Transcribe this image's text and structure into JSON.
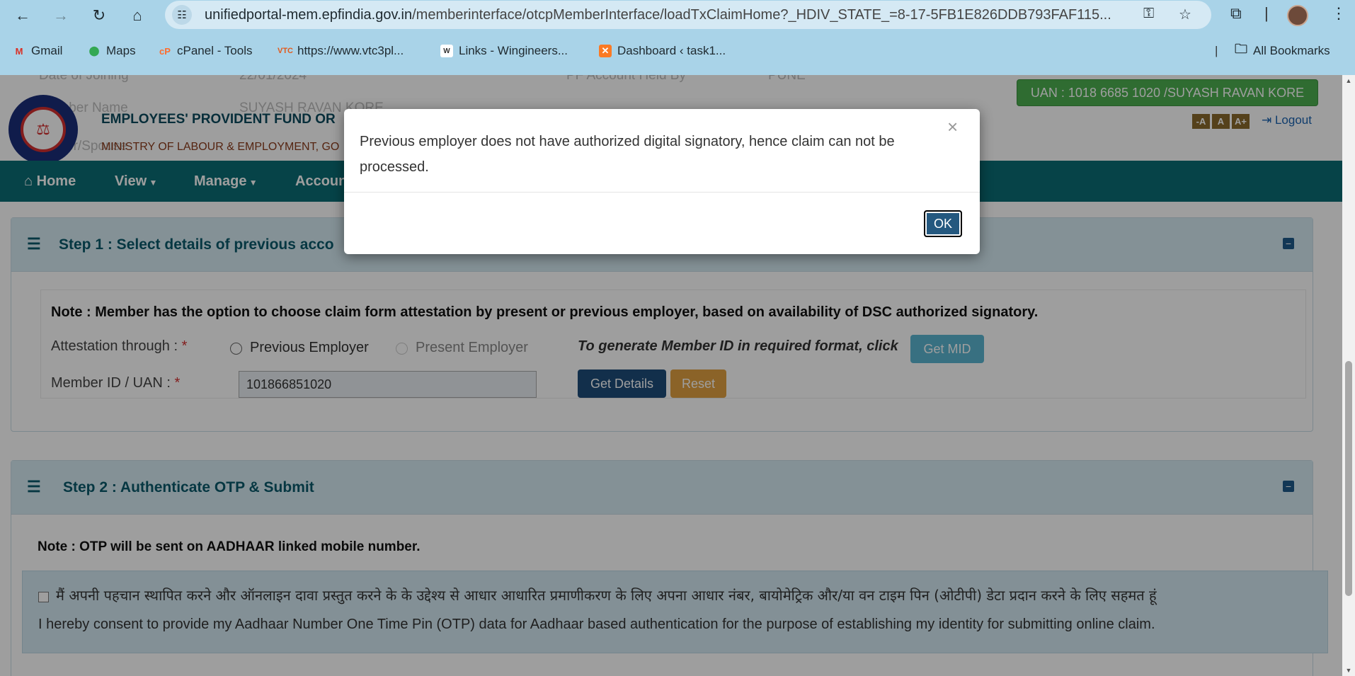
{
  "browser": {
    "url_host": "unifiedportal-mem.epfindia.gov.in",
    "url_path": "/memberinterface/otcpMemberInterface/loadTxClaimHome?_HDIV_STATE_=8-17-5FB1E826DDB793FAF115...",
    "bookmarks": [
      {
        "label": "Gmail",
        "icon": "gmail-icon"
      },
      {
        "label": "Maps",
        "icon": "maps-icon"
      },
      {
        "label": "cPanel - Tools",
        "icon": "cpanel-icon"
      },
      {
        "label": "https://www.vtc3pl...",
        "icon": "vtc-icon"
      },
      {
        "label": "Links - Wingineers...",
        "icon": "wingineers-icon"
      },
      {
        "label": "Dashboard ‹ task1...",
        "icon": "xampp-icon"
      }
    ],
    "all_bookmarks": "All Bookmarks"
  },
  "header": {
    "ghost_row1_label": "Date of Joining",
    "ghost_row1_value": "22/01/2024",
    "ghost_row1_label2": "PF Account Held By",
    "ghost_row1_value2": "PUNE",
    "ghost_row2_label": "Member Name",
    "ghost_row2_value": "SUYASH RAVAN KORE",
    "ghost_row3_label": "Father/Spouse",
    "org_title": "EMPLOYEES' PROVIDENT FUND OR",
    "org_subtitle": "MINISTRY OF LABOUR & EMPLOYMENT, GO",
    "uan_badge": "UAN : 1018 6685 1020 /SUYASH RAVAN KORE",
    "font_small": "-A",
    "font_normal": "A",
    "font_large": "A+",
    "logout": "Logout"
  },
  "nav": {
    "home": "Home",
    "view": "View",
    "manage": "Manage",
    "account": "Accoun"
  },
  "step1": {
    "title": "Step 1 : Select details of previous acco",
    "note": "Note : Member has the option to choose claim form attestation by present or previous employer, based on availability of DSC authorized signatory.",
    "attestation_label": "Attestation through :",
    "required_mark": "*",
    "option_previous": "Previous Employer",
    "option_present": "Present Employer",
    "mid_note": "To generate Member ID in required format, click",
    "get_mid": "Get MID",
    "member_id_label": "Member ID / UAN :",
    "member_id_value": "101866851020",
    "get_details": "Get Details",
    "reset": "Reset"
  },
  "step2": {
    "title": "Step 2 : Authenticate OTP & Submit",
    "note": "Note : OTP will be sent on AADHAAR linked mobile number.",
    "consent_hindi": "मैं अपनी पहचान स्थापित करने और ऑनलाइन दावा प्रस्तुत करने के के उद्देश्य से आधार आधारित प्रमाणीकरण के लिए अपना आधार नंबर, बायोमेट्रिक और/या वन टाइम पिन (ओटीपी) डेटा प्रदान करने के लिए सहमत हूं",
    "consent_english": "I hereby consent to provide my Aadhaar Number One Time Pin (OTP) data for Aadhaar based authentication for the purpose of establishing my identity for submitting online claim."
  },
  "modal": {
    "message": "Previous employer does not have authorized digital signatory, hence claim can not be processed.",
    "close": "×",
    "ok": "OK"
  },
  "colors": {
    "navbar": "#0a6d74",
    "uan_badge": "#4caf50",
    "get_details": "#1e4d7a",
    "reset": "#e0a141",
    "get_mid": "#5bb5d0",
    "ok": "#24587f"
  }
}
